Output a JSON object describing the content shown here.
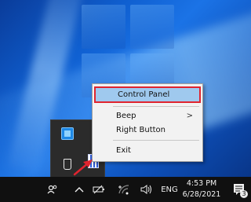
{
  "context_menu": {
    "items": [
      {
        "label": "Control Panel",
        "highlighted": true
      },
      {
        "label": "Beep",
        "submenu_arrow": ">"
      },
      {
        "label": "Right Button"
      },
      {
        "label": "Exit"
      }
    ]
  },
  "taskbar": {
    "language": "ENG",
    "time": "4:53 PM",
    "date": "6/28/2021",
    "notification_count": "3"
  },
  "colors": {
    "highlight_border": "#e0242f",
    "highlight_fill": "#9fc9ee",
    "annotation_arrow": "#e0242f"
  }
}
